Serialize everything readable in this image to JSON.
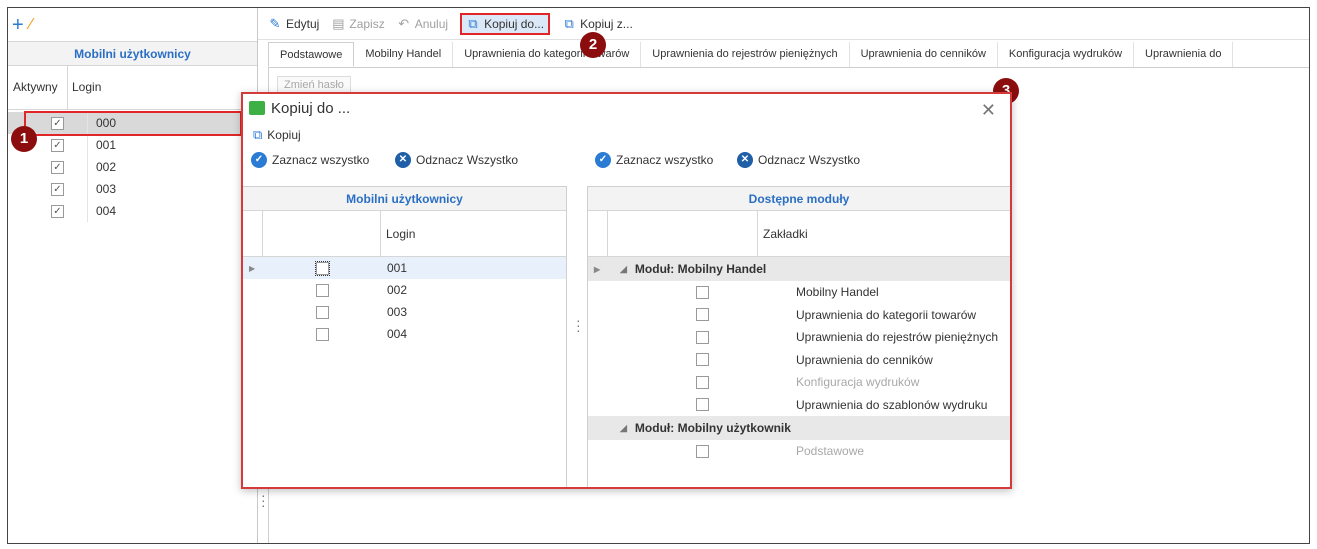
{
  "left_panel": {
    "grid_title": "Mobilni użytkownicy",
    "col_active": "Aktywny",
    "col_login": "Login",
    "rows": [
      {
        "login": "000",
        "active": true
      },
      {
        "login": "001",
        "active": true
      },
      {
        "login": "002",
        "active": true
      },
      {
        "login": "003",
        "active": true
      },
      {
        "login": "004",
        "active": true
      }
    ]
  },
  "toolbar": {
    "edit": "Edytuj",
    "save": "Zapisz",
    "cancel": "Anuluj",
    "copy_to": "Kopiuj do...",
    "copy_from": "Kopiuj z..."
  },
  "tabs": [
    "Podstawowe",
    "Mobilny Handel",
    "Uprawnienia do kategorii towarów",
    "Uprawnienia do rejestrów pieniężnych",
    "Uprawnienia do cenników",
    "Konfiguracja wydruków",
    "Uprawnienia do"
  ],
  "content": {
    "change_password": "Zmień hasło"
  },
  "badges": [
    "1",
    "2",
    "3"
  ],
  "dialog": {
    "title": "Kopiuj do ...",
    "copy": "Kopiuj",
    "select_all": "Zaznacz wszystko",
    "deselect_all": "Odznacz Wszystko",
    "left_title": "Mobilni użytkownicy",
    "left_col": "Login",
    "users": [
      "001",
      "002",
      "003",
      "004"
    ],
    "right_title": "Dostępne moduły",
    "right_col": "Zakładki",
    "group1": "Moduł: Mobilny Handel",
    "group1_items": [
      "Mobilny Handel",
      "Uprawnienia do kategorii towarów",
      "Uprawnienia do rejestrów pieniężnych",
      "Uprawnienia do cenników",
      "Konfiguracja wydruków",
      "Uprawnienia do szablonów wydruku"
    ],
    "group2": "Moduł: Mobilny użytkownik",
    "group2_items": [
      "Podstawowe"
    ]
  },
  "colors": {
    "accent": "#2a6fc4",
    "highlight": "#e02626",
    "badge": "#8b0d0d"
  }
}
